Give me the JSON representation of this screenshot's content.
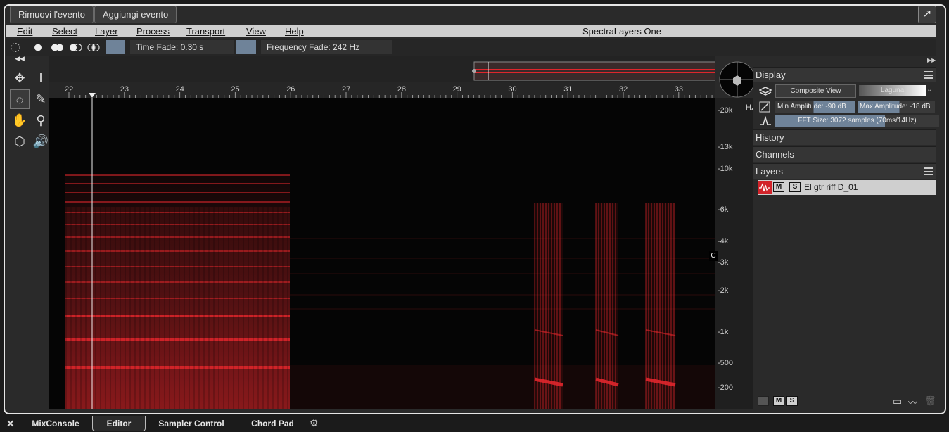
{
  "top_buttons": {
    "remove_event": "Rimuovi l'evento",
    "add_event": "Aggiungi evento"
  },
  "menu": {
    "items": [
      "Edit",
      "Select",
      "Layer",
      "Process",
      "Transport",
      "View",
      "Help"
    ],
    "app_title": "SpectraLayers One"
  },
  "toolstrip": {
    "time_fade": "Time Fade: 0.30 s",
    "frequency_fade": "Frequency Fade: 242 Hz"
  },
  "ruler": {
    "ticks": [
      "22",
      "23",
      "24",
      "25",
      "26",
      "27",
      "28",
      "29",
      "30",
      "31",
      "32",
      "33"
    ]
  },
  "hz_axis": {
    "unit": "Hz",
    "labels": [
      "20k",
      "13k",
      "10k",
      "6k",
      "4k",
      "3k",
      "2k",
      "1k",
      "500",
      "200"
    ],
    "key_badge": "C"
  },
  "right_panel": {
    "display_header": "Display",
    "composite_view": "Composite View",
    "colormap": "Laguna",
    "min_amplitude": "Min Amplitude: -90 dB",
    "max_amplitude": "Max Amplitude: -18 dB",
    "fft_size": "FFT Size: 3072 samples (70ms/14Hz)",
    "history_header": "History",
    "channels_header": "Channels",
    "layers_header": "Layers",
    "layer_name": "El gtr riff D_01",
    "mute_label": "M",
    "solo_label": "S"
  },
  "bottom_tabs": {
    "mixconsole": "MixConsole",
    "editor": "Editor",
    "sampler": "Sampler Control",
    "chordpad": "Chord Pad"
  },
  "colors": {
    "spectrum": "#e0262c",
    "menu_bg": "#cfcfcf",
    "accent_swatch": "#6f8399"
  }
}
